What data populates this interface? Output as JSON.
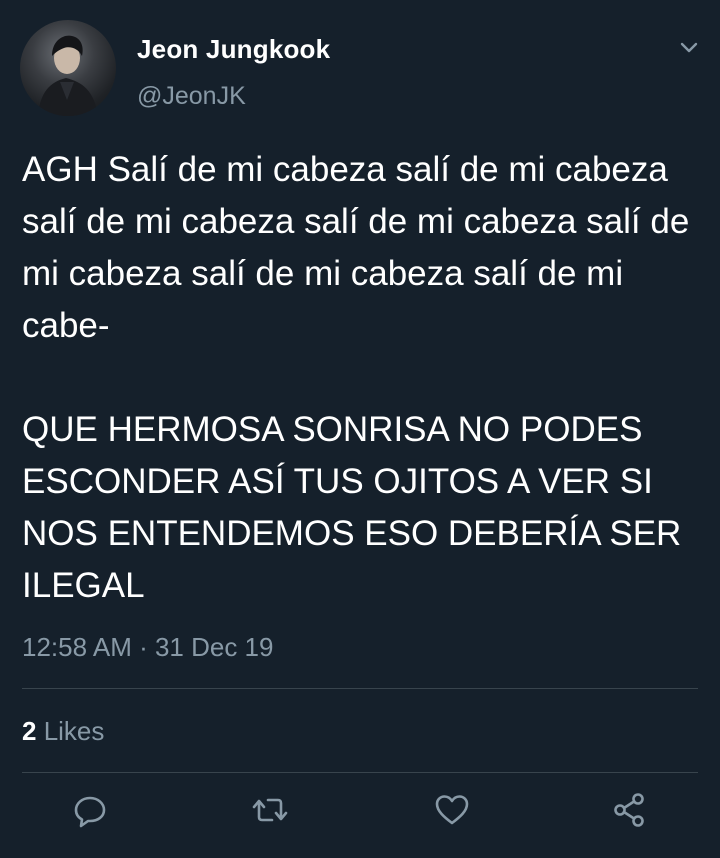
{
  "tweet": {
    "author_name": "Jeon Jungkook",
    "author_handle": "@JeonJK",
    "text": "AGH Salí de mi cabeza salí de mi cabeza salí de mi cabeza salí de mi cabeza salí de mi cabeza salí de mi cabeza salí de mi cabe-\n\nQUE HERMOSA SONRISA NO PODES ESCONDER ASÍ TUS OJITOS A VER SI NOS ENTENDEMOS ESO DEBERÍA SER ILEGAL",
    "timestamp": "12:58 AM · 31 Dec 19",
    "likes_count": "2",
    "likes_label": " Likes"
  },
  "icons": {
    "menu": "chevron-down-icon",
    "reply": "reply-icon",
    "retweet": "retweet-icon",
    "like": "heart-icon",
    "share": "share-icon"
  },
  "colors": {
    "background": "#15202b",
    "text": "#ffffff",
    "secondary_text": "#8899a6",
    "divider": "#38444d"
  }
}
